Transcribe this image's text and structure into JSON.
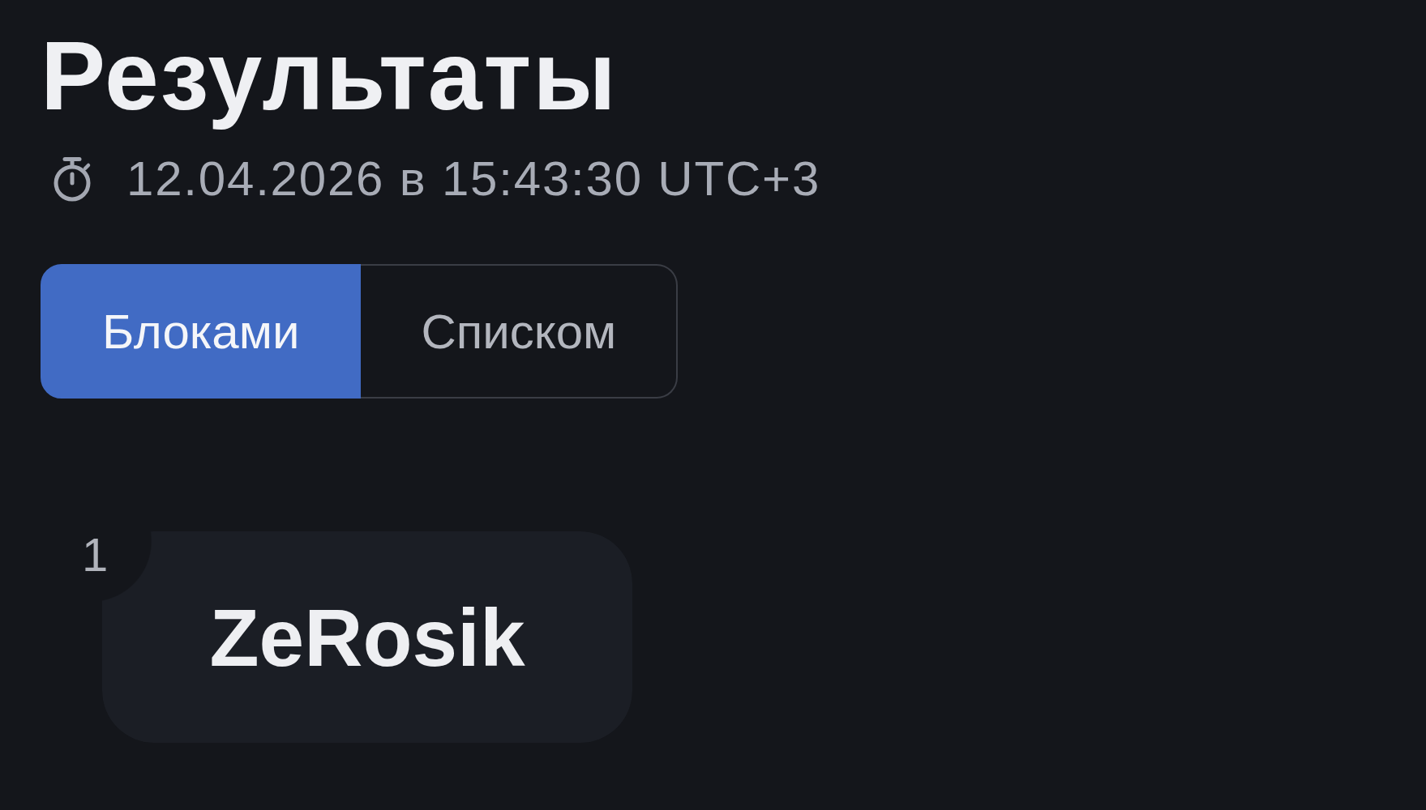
{
  "title": "Результаты",
  "timestamp": "12.04.2026 в 15:43:30 UTC+3",
  "view_toggle": [
    {
      "label": "Блоками",
      "selected": true
    },
    {
      "label": "Списком",
      "selected": false
    }
  ],
  "results": [
    {
      "rank": "1",
      "name": "ZeRosik"
    }
  ]
}
